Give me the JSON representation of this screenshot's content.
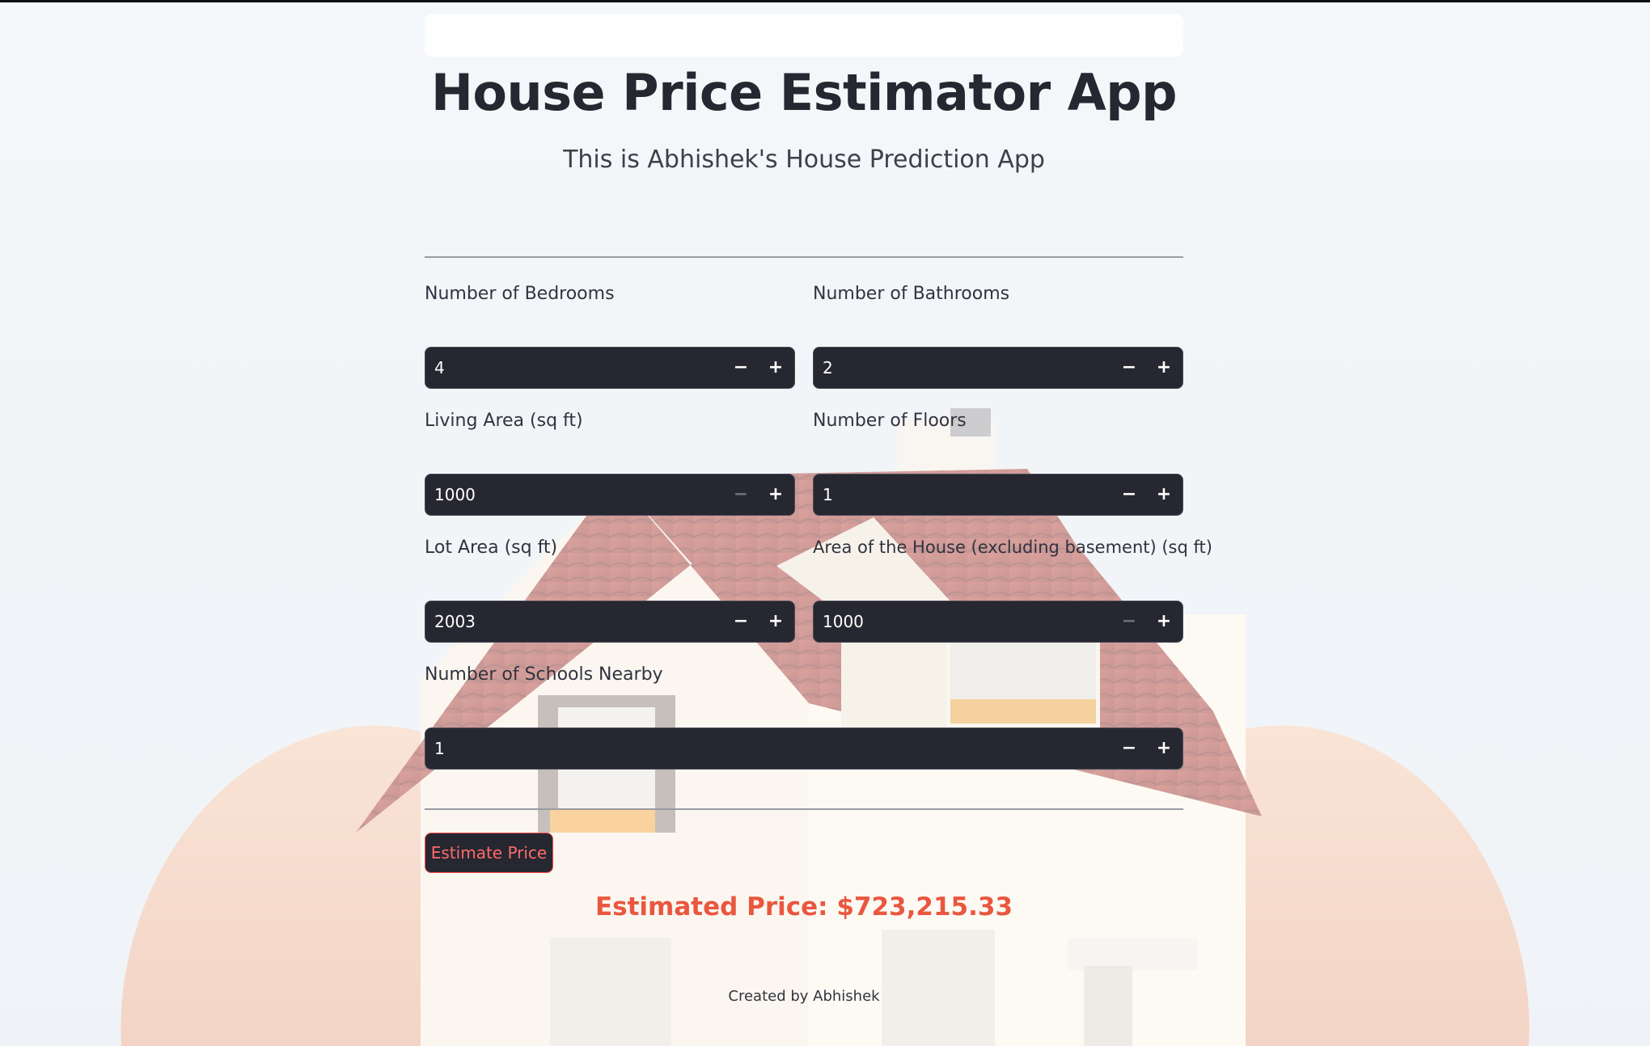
{
  "app": {
    "title": "House Price Estimator App",
    "subtitle": "This is Abhishek's House Prediction App"
  },
  "form": {
    "bedrooms": {
      "label": "Number of Bedrooms",
      "value": "4"
    },
    "bathrooms": {
      "label": "Number of Bathrooms",
      "value": "2"
    },
    "living_area": {
      "label": "Living Area (sq ft)",
      "value": "1000"
    },
    "floors": {
      "label": "Number of Floors",
      "value": "1"
    },
    "lot_area": {
      "label": "Lot Area (sq ft)",
      "value": "2003"
    },
    "house_area": {
      "label": "Area of the House (excluding basement) (sq ft)",
      "value": "1000"
    },
    "schools": {
      "label": "Number of Schools Nearby",
      "value": "1"
    },
    "stepper": {
      "decrement": "−",
      "increment": "+"
    }
  },
  "action": {
    "estimate_label": "Estimate Price"
  },
  "result": {
    "text": "Estimated Price: $723,215.33"
  },
  "footer": {
    "text": "Created by Abhishek"
  },
  "colors": {
    "input_bg": "#262730",
    "accent": "#ff4b4b",
    "result": "#e9573f",
    "title": "#262730"
  },
  "icons": {
    "decrement": "minus-icon",
    "increment": "plus-icon"
  }
}
